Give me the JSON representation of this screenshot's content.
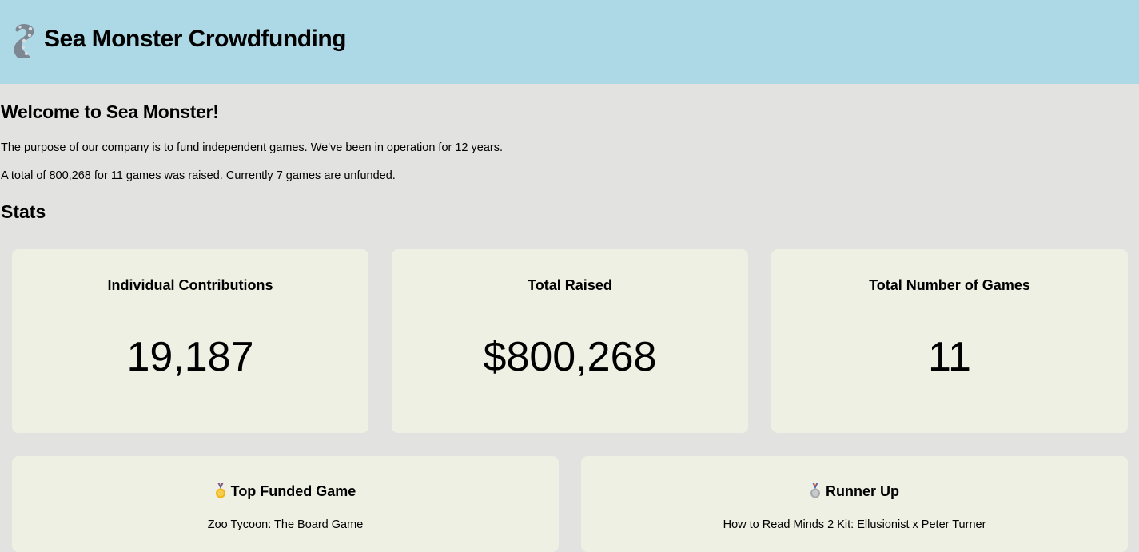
{
  "header": {
    "title": "Sea Monster Crowdfunding",
    "logo_icon": "tentacle-icon",
    "background": "#add8e6"
  },
  "intro": {
    "heading": "Welcome to Sea Monster!",
    "paragraph1": "The purpose of our company is to fund independent games. We've been in operation for 12 years.",
    "paragraph2": "A total of 800,268 for 11 games was raised. Currently 7 games are unfunded."
  },
  "stats": {
    "heading": "Stats",
    "cards": [
      {
        "label": "Individual Contributions",
        "value": "19,187"
      },
      {
        "label": "Total Raised",
        "value": "$800,268"
      },
      {
        "label": "Total Number of Games",
        "value": "11"
      }
    ]
  },
  "games": {
    "top": {
      "icon": "gold-medal-icon",
      "label": "Top Funded Game",
      "name": "Zoo Tycoon: The Board Game"
    },
    "runner_up": {
      "icon": "silver-medal-icon",
      "label": "Runner Up",
      "name": "How to Read Minds 2 Kit: Ellusionist x Peter Turner"
    }
  },
  "colors": {
    "page_background": "#e2e2e1",
    "card_background": "#eef0e3",
    "gold": "#f2b519",
    "silver": "#a7a9ac"
  }
}
